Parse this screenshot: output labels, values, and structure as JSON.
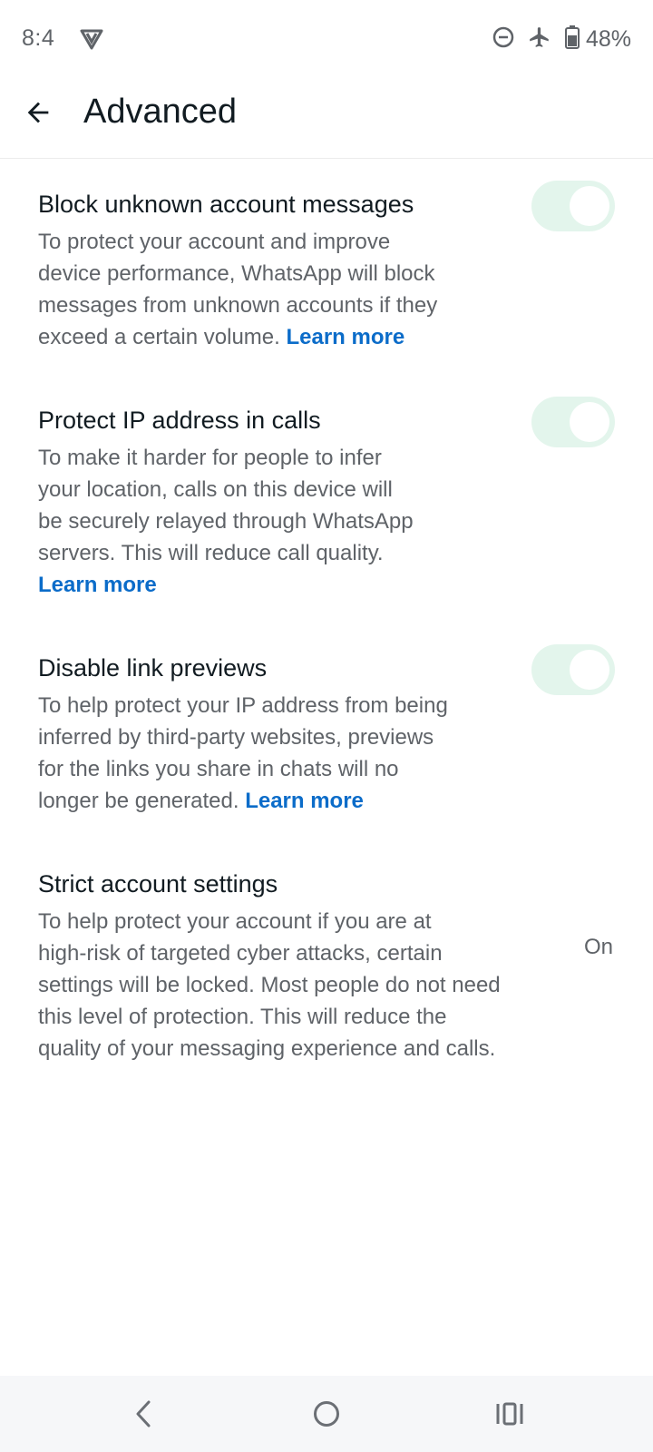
{
  "status_bar": {
    "time": "8:4",
    "battery": "48%",
    "icons": [
      "vpn-icon",
      "do-not-disturb-icon",
      "airplane-mode-icon",
      "battery-icon"
    ]
  },
  "app_bar": {
    "title": "Advanced",
    "back_icon": "arrow-left-icon"
  },
  "settings": [
    {
      "title": "Block unknown account messages",
      "desc_lines": [
        "To protect your account and improve",
        "device performance, WhatsApp will block",
        "messages from unknown accounts if they",
        "exceed a certain volume."
      ],
      "learn_more": "Learn more",
      "control": "toggle",
      "enabled": true
    },
    {
      "title": "Protect IP address in calls",
      "desc_lines": [
        "To make it harder for people to infer",
        "your location, calls on this device will",
        "be securely relayed through WhatsApp",
        "servers. This will reduce call quality."
      ],
      "learn_more": "Learn more",
      "control": "toggle",
      "enabled": true
    },
    {
      "title": "Disable link previews",
      "desc_lines": [
        "To help protect your IP address from being",
        "inferred by third-party websites, previews",
        "for the links you share in chats will no",
        "longer be generated."
      ],
      "learn_more": "Learn more",
      "control": "toggle",
      "enabled": true
    },
    {
      "title": "Strict account settings",
      "desc_lines": [
        "To help protect your account if you are at",
        "high-risk of targeted cyber attacks, certain",
        "settings will be locked. Most people do not need",
        "this level of protection. This will reduce the",
        "quality of your messaging experience and calls."
      ],
      "value": "On",
      "control": "value"
    }
  ],
  "colors": {
    "toggle_track": "#e3f5ec",
    "link": "#0b6cc9",
    "title_text": "#111b21",
    "secondary_text": "#5f6368"
  },
  "nav_bar": {
    "icons": [
      "nav-back-icon",
      "nav-home-icon",
      "nav-recents-icon"
    ]
  }
}
